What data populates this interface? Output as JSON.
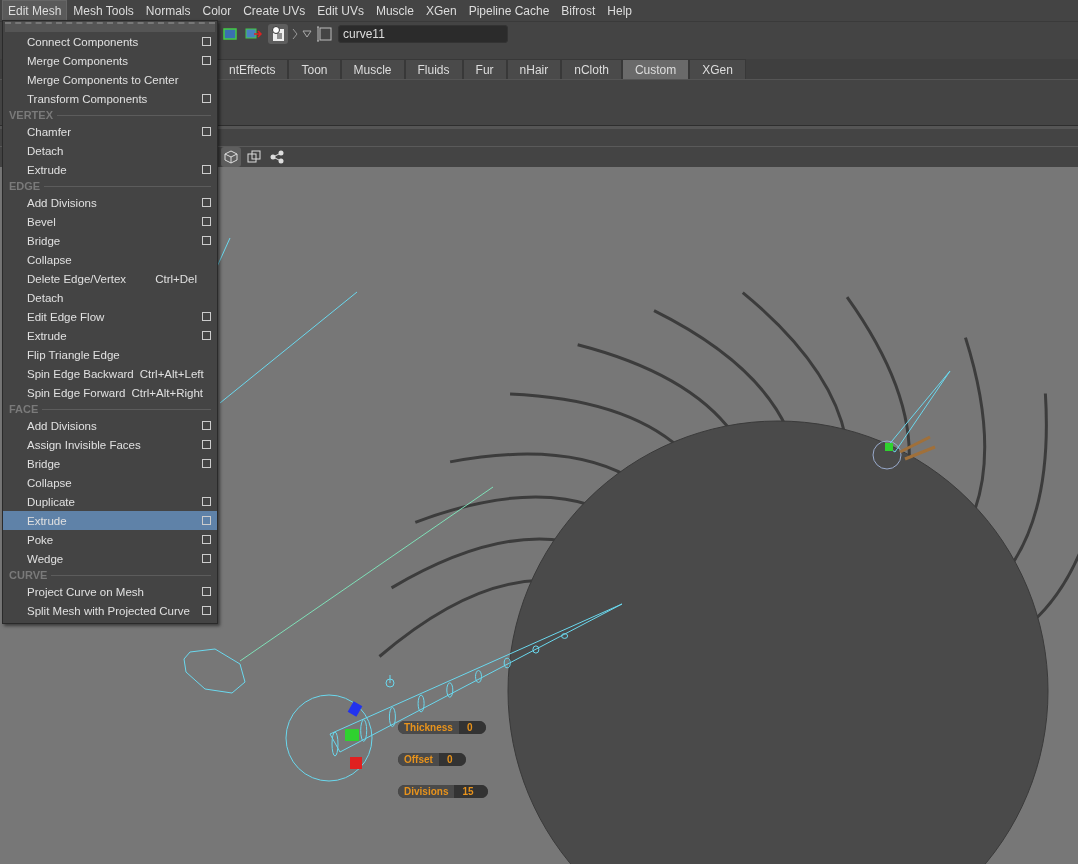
{
  "menu_bar": [
    {
      "label": "Edit Mesh",
      "selected": true
    },
    {
      "label": "Mesh Tools",
      "selected": false
    },
    {
      "label": "Normals",
      "selected": false
    },
    {
      "label": "Color",
      "selected": false
    },
    {
      "label": "Create UVs",
      "selected": false
    },
    {
      "label": "Edit UVs",
      "selected": false
    },
    {
      "label": "Muscle",
      "selected": false
    },
    {
      "label": "XGen",
      "selected": false
    },
    {
      "label": "Pipeline Cache",
      "selected": false
    },
    {
      "label": "Bifrost",
      "selected": false
    },
    {
      "label": "Help",
      "selected": false
    }
  ],
  "toolbar": {
    "name_field": {
      "value": "curve11"
    }
  },
  "shelf_tabs": [
    {
      "label": "ntEffects",
      "selected": false
    },
    {
      "label": "Toon",
      "selected": false
    },
    {
      "label": "Muscle",
      "selected": false
    },
    {
      "label": "Fluids",
      "selected": false
    },
    {
      "label": "Fur",
      "selected": false
    },
    {
      "label": "nHair",
      "selected": false
    },
    {
      "label": "nCloth",
      "selected": false
    },
    {
      "label": "Custom",
      "selected": true
    },
    {
      "label": "XGen",
      "selected": false
    }
  ],
  "edit_mesh_menu": [
    {
      "kind": "item",
      "label": "Connect Components",
      "option_box": true,
      "selected": false
    },
    {
      "kind": "item",
      "label": "Merge Components",
      "option_box": true,
      "selected": false
    },
    {
      "kind": "item",
      "label": "Merge Components to Center",
      "option_box": false,
      "selected": false
    },
    {
      "kind": "item",
      "label": "Transform Components",
      "option_box": true,
      "selected": false
    },
    {
      "kind": "section",
      "label": "VERTEX"
    },
    {
      "kind": "item",
      "label": "Chamfer",
      "option_box": true,
      "selected": false
    },
    {
      "kind": "item",
      "label": "Detach",
      "option_box": false,
      "selected": false
    },
    {
      "kind": "item",
      "label": "Extrude",
      "option_box": true,
      "selected": false
    },
    {
      "kind": "section",
      "label": "EDGE"
    },
    {
      "kind": "item",
      "label": "Add Divisions",
      "option_box": true,
      "selected": false
    },
    {
      "kind": "item",
      "label": "Bevel",
      "option_box": true,
      "selected": false
    },
    {
      "kind": "item",
      "label": "Bridge",
      "option_box": true,
      "selected": false
    },
    {
      "kind": "item",
      "label": "Collapse",
      "option_box": false,
      "selected": false
    },
    {
      "kind": "item",
      "label": "Delete Edge/Vertex",
      "shortcut": "Ctrl+Del",
      "option_box": false,
      "selected": false
    },
    {
      "kind": "item",
      "label": "Detach",
      "option_box": false,
      "selected": false
    },
    {
      "kind": "item",
      "label": "Edit Edge Flow",
      "option_box": true,
      "selected": false
    },
    {
      "kind": "item",
      "label": "Extrude",
      "option_box": true,
      "selected": false
    },
    {
      "kind": "item",
      "label": "Flip Triangle Edge",
      "option_box": false,
      "selected": false
    },
    {
      "kind": "item",
      "label": "Spin Edge Backward",
      "shortcut": "Ctrl+Alt+Left",
      "option_box": false,
      "selected": false
    },
    {
      "kind": "item",
      "label": "Spin Edge Forward",
      "shortcut": "Ctrl+Alt+Right",
      "option_box": false,
      "selected": false
    },
    {
      "kind": "section",
      "label": "FACE"
    },
    {
      "kind": "item",
      "label": "Add Divisions",
      "option_box": true,
      "selected": false
    },
    {
      "kind": "item",
      "label": "Assign Invisible Faces",
      "option_box": true,
      "selected": false
    },
    {
      "kind": "item",
      "label": "Bridge",
      "option_box": true,
      "selected": false
    },
    {
      "kind": "item",
      "label": "Collapse",
      "option_box": false,
      "selected": false
    },
    {
      "kind": "item",
      "label": "Duplicate",
      "option_box": true,
      "selected": false
    },
    {
      "kind": "item",
      "label": "Extrude",
      "option_box": true,
      "selected": true
    },
    {
      "kind": "item",
      "label": "Poke",
      "option_box": true,
      "selected": false
    },
    {
      "kind": "item",
      "label": "Wedge",
      "option_box": true,
      "selected": false
    },
    {
      "kind": "section",
      "label": "CURVE"
    },
    {
      "kind": "item",
      "label": "Project Curve on Mesh",
      "option_box": true,
      "selected": false
    },
    {
      "kind": "item",
      "label": "Split Mesh with Projected Curve",
      "option_box": true,
      "selected": false
    }
  ],
  "viewport": {
    "hud_fields": [
      {
        "label": "Thickness",
        "value": "0"
      },
      {
        "label": "Offset",
        "value": "0"
      },
      {
        "label": "Divisions",
        "value": "15"
      }
    ]
  }
}
